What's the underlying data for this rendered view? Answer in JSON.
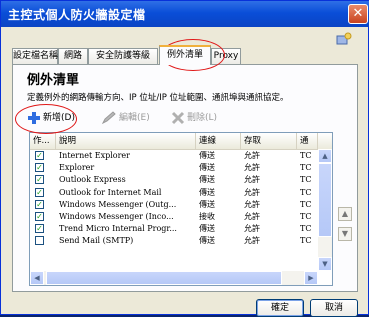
{
  "window": {
    "title": "主控式個人防火牆設定檔",
    "close_label": "✕"
  },
  "tabs": [
    {
      "label": "設定檔名稱"
    },
    {
      "label": "網路"
    },
    {
      "label": "安全防護等級"
    },
    {
      "label": "例外清單"
    },
    {
      "label": "Proxy"
    }
  ],
  "panel": {
    "heading": "例外清單",
    "description": "定義例外的網路傳輸方向、IP 位址/IP 位址範圍、通訊埠與通訊協定。"
  },
  "toolbar": {
    "add_label": "新增(D)",
    "edit_label": "編輯(E)",
    "delete_label": "刪除(L)"
  },
  "list": {
    "columns": [
      "作...",
      "說明",
      "連線",
      "存取",
      "通"
    ],
    "rows": [
      {
        "checked": true,
        "name": "Internet Explorer",
        "direction": "傳送",
        "access": "允許",
        "protocol": "TC"
      },
      {
        "checked": true,
        "name": "Explorer",
        "direction": "傳送",
        "access": "允許",
        "protocol": "TC"
      },
      {
        "checked": true,
        "name": "Outlook Express",
        "direction": "傳送",
        "access": "允許",
        "protocol": "TC"
      },
      {
        "checked": true,
        "name": "Outlook for Internet Mail",
        "direction": "傳送",
        "access": "允許",
        "protocol": "TC"
      },
      {
        "checked": true,
        "name": "Windows Messenger (Outg...",
        "direction": "傳送",
        "access": "允許",
        "protocol": "TC"
      },
      {
        "checked": true,
        "name": "Windows Messenger (Inco...",
        "direction": "接收",
        "access": "允許",
        "protocol": "TC"
      },
      {
        "checked": true,
        "name": "Trend Micro Internal Progr...",
        "direction": "傳送",
        "access": "允許",
        "protocol": "TC"
      },
      {
        "checked": false,
        "name": "Send Mail (SMTP)",
        "direction": "傳送",
        "access": "允許",
        "protocol": "TC"
      }
    ]
  },
  "footer": {
    "ok_label": "確定",
    "cancel_label": "取消"
  },
  "colors": {
    "titlebar": "#0a4ed8",
    "highlight_circle": "#e01818",
    "check": "#21a121"
  }
}
